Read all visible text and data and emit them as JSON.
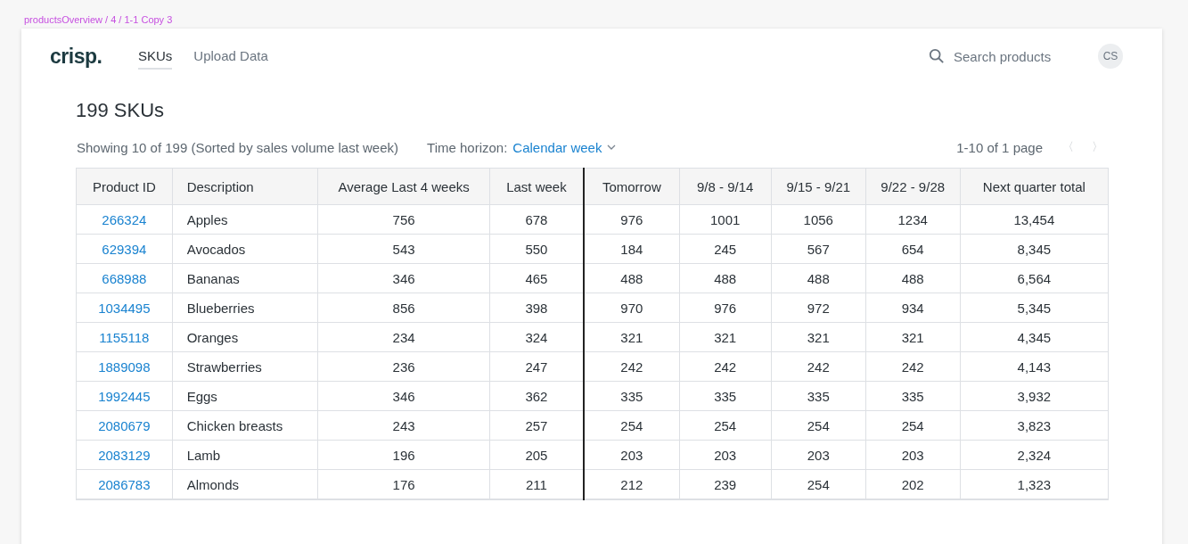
{
  "frame_label": "productsOverview / 4 / 1-1 Copy 3",
  "logo": "crisp.",
  "tabs": [
    {
      "label": "SKUs",
      "selected": true
    },
    {
      "label": "Upload Data",
      "selected": false
    }
  ],
  "search": {
    "placeholder": "Search products"
  },
  "avatar": "CS",
  "heading": "199 SKUs",
  "summary": "Showing 10 of 199 (Sorted by sales volume last week)",
  "time_horizon": {
    "label": "Time horizon:",
    "value": "Calendar week"
  },
  "pagination": {
    "text": "1-10 of 1 page",
    "prev": "〈",
    "next": "〉",
    "prev_disabled": true,
    "next_disabled": true
  },
  "table": {
    "columns": [
      "Product ID",
      "Description",
      "Average Last 4 weeks",
      "Last week",
      "Tomorrow",
      "9/8 - 9/14",
      "9/15 - 9/21",
      "9/22 - 9/28",
      "Next quarter total"
    ],
    "rows": [
      [
        "266324",
        "Apples",
        "756",
        "678",
        "976",
        "1001",
        "1056",
        "1234",
        "13,454"
      ],
      [
        "629394",
        "Avocados",
        "543",
        "550",
        "184",
        "245",
        "567",
        "654",
        "8,345"
      ],
      [
        "668988",
        "Bananas",
        "346",
        "465",
        "488",
        "488",
        "488",
        "488",
        "6,564"
      ],
      [
        "1034495",
        "Blueberries",
        "856",
        "398",
        "970",
        "976",
        "972",
        "934",
        "5,345"
      ],
      [
        "1155118",
        "Oranges",
        "234",
        "324",
        "321",
        "321",
        "321",
        "321",
        "4,345"
      ],
      [
        "1889098",
        "Strawberries",
        "236",
        "247",
        "242",
        "242",
        "242",
        "242",
        "4,143"
      ],
      [
        "1992445",
        "Eggs",
        "346",
        "362",
        "335",
        "335",
        "335",
        "335",
        "3,932"
      ],
      [
        "2080679",
        "Chicken breasts",
        "243",
        "257",
        "254",
        "254",
        "254",
        "254",
        "3,823"
      ],
      [
        "2083129",
        "Lamb",
        "196",
        "205",
        "203",
        "203",
        "203",
        "203",
        "2,324"
      ],
      [
        "2086783",
        "Almonds",
        "176",
        "211",
        "212",
        "239",
        "254",
        "202",
        "1,323"
      ]
    ]
  }
}
